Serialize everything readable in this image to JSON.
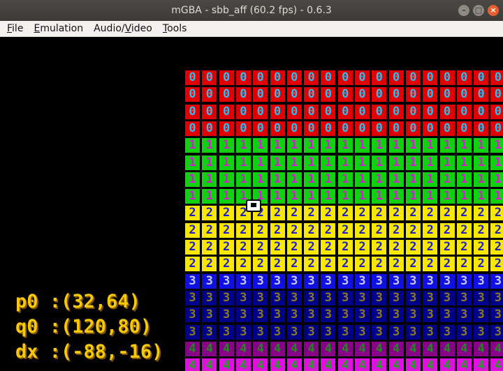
{
  "window": {
    "title": "mGBA - sbb_aff (60.2 fps) - 0.6.3",
    "buttons": [
      "minimize",
      "maximize",
      "close"
    ]
  },
  "menu": [
    {
      "label_prefix": "",
      "mnemonic": "F",
      "label_rest": "ile"
    },
    {
      "label_prefix": "",
      "mnemonic": "E",
      "label_rest": "mulation"
    },
    {
      "label_prefix": "Audio/",
      "mnemonic": "V",
      "label_rest": "ideo"
    },
    {
      "label_prefix": "",
      "mnemonic": "T",
      "label_rest": "ools"
    }
  ],
  "game": {
    "tile_bands": [
      {
        "digit": "0",
        "rows": 4,
        "bg": "#e00000",
        "fg": "#38b8e8"
      },
      {
        "digit": "1",
        "rows": 4,
        "bg": "#10d010",
        "fg": "#d020d0"
      },
      {
        "digit": "2",
        "rows": 4,
        "bg": "#f8e800",
        "fg": "#2020c8"
      },
      {
        "digit": "3",
        "rows": 1,
        "bg": "#1010e0",
        "fg": "#c8c8e8"
      },
      {
        "digit": "3",
        "rows": 3,
        "bg": "#000088",
        "fg": "#8a7a20"
      },
      {
        "digit": "4",
        "rows": 1,
        "bg": "#880088",
        "fg": "#208820"
      },
      {
        "digit": "4",
        "rows": 1,
        "bg": "#e010e0",
        "fg": "#20a020"
      }
    ],
    "columns": 19,
    "readout": [
      {
        "label": "p0",
        "value": ":(32,64)"
      },
      {
        "label": "q0",
        "value": ":(120,80)"
      },
      {
        "label": "dx",
        "value": ":(-88,-16)"
      }
    ]
  }
}
